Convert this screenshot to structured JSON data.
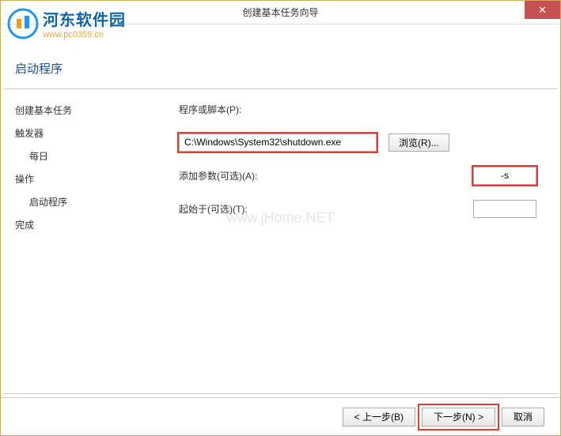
{
  "window": {
    "title": "创建基本任务向导",
    "close": "✕"
  },
  "logo": {
    "title": "河东软件园",
    "subtitle": "www.pc0359.cn"
  },
  "header": {
    "title": "启动程序"
  },
  "sidebar": {
    "items": [
      {
        "label": "创建基本任务",
        "type": "item"
      },
      {
        "label": "触发器",
        "type": "item"
      },
      {
        "label": "每日",
        "type": "subitem"
      },
      {
        "label": "操作",
        "type": "item"
      },
      {
        "label": "启动程序",
        "type": "subitem",
        "selected": true
      },
      {
        "label": "完成",
        "type": "item"
      }
    ]
  },
  "form": {
    "program_label": "程序或脚本(P):",
    "program_value": "C:\\Windows\\System32\\shutdown.exe",
    "browse_label": "浏览(R)...",
    "args_label": "添加参数(可选)(A):",
    "args_value": "-s",
    "start_label": "起始于(可选)(T):",
    "start_value": ""
  },
  "watermark": "www.jHome.NET",
  "footer": {
    "back": "< 上一步(B)",
    "next": "下一步(N) >",
    "cancel": "取消"
  }
}
